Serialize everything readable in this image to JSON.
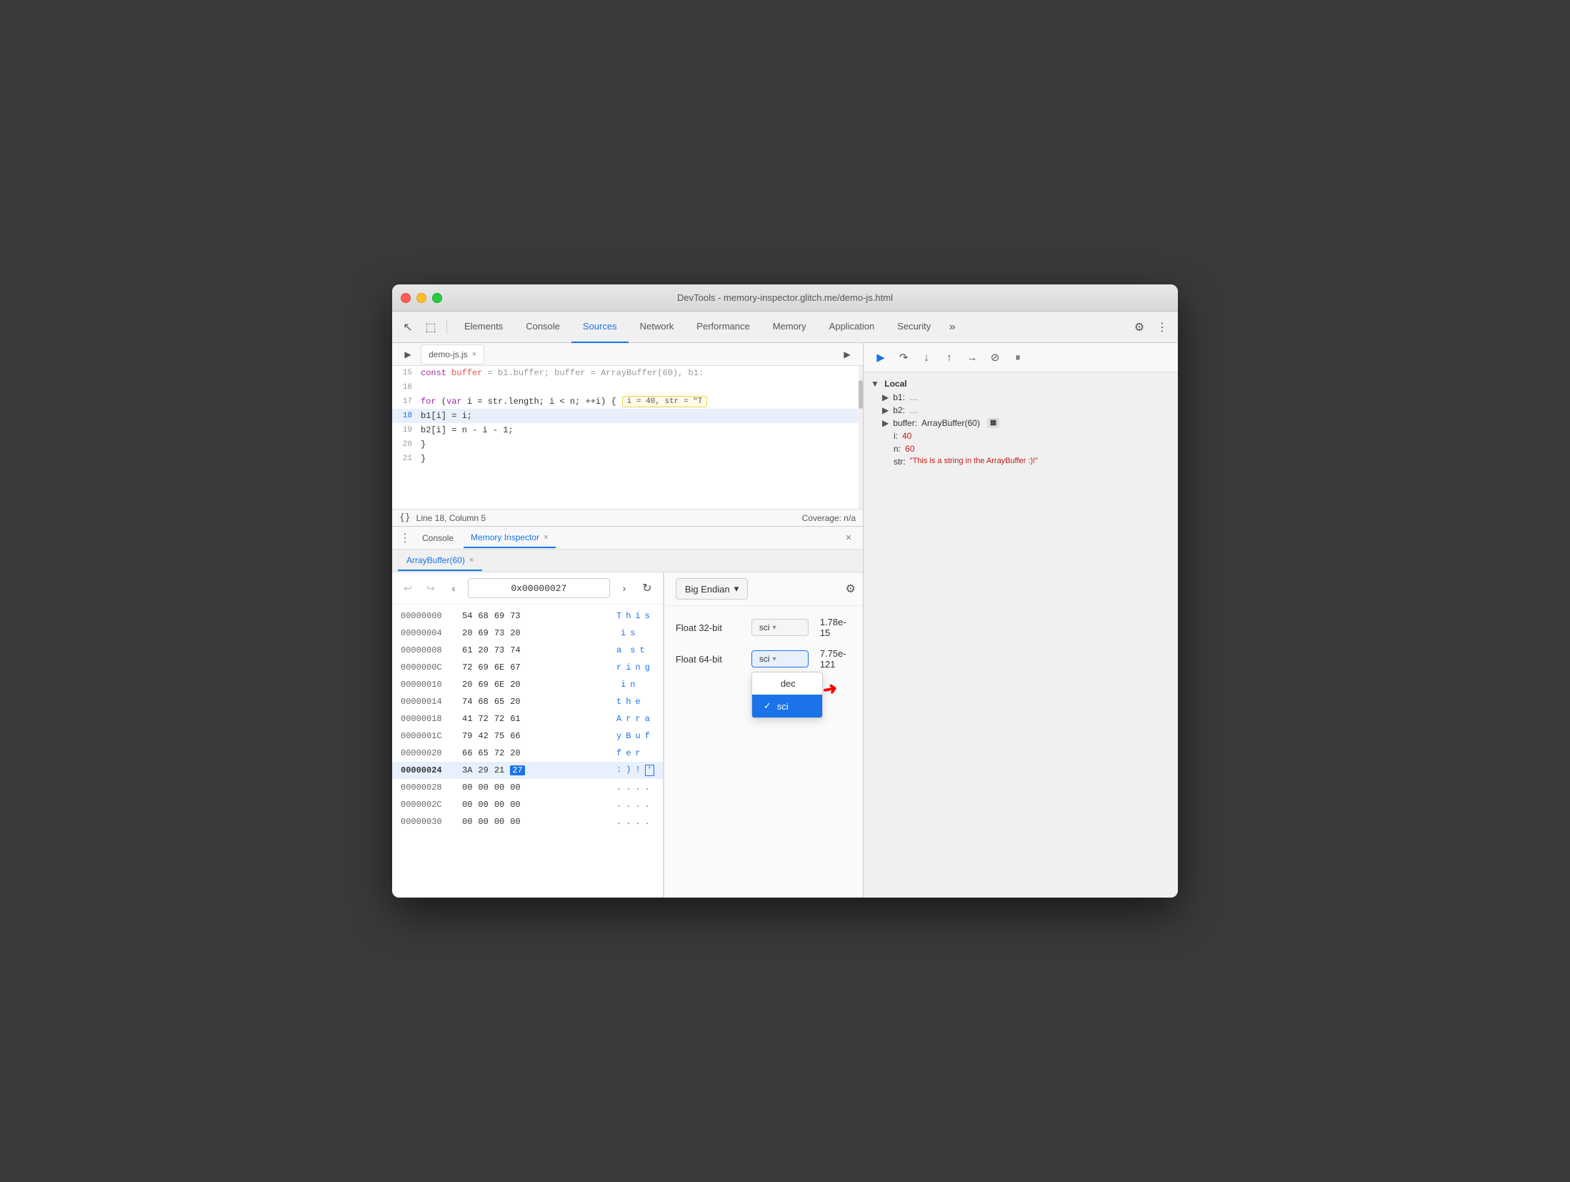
{
  "window": {
    "title": "DevTools - memory-inspector.glitch.me/demo-js.html",
    "traffic_lights": [
      "red",
      "yellow",
      "green"
    ]
  },
  "devtools": {
    "tabs": [
      {
        "id": "elements",
        "label": "Elements",
        "active": false
      },
      {
        "id": "console",
        "label": "Console",
        "active": false
      },
      {
        "id": "sources",
        "label": "Sources",
        "active": true
      },
      {
        "id": "network",
        "label": "Network",
        "active": false
      },
      {
        "id": "performance",
        "label": "Performance",
        "active": false
      },
      {
        "id": "memory",
        "label": "Memory",
        "active": false
      },
      {
        "id": "application",
        "label": "Application",
        "active": false
      },
      {
        "id": "security",
        "label": "Security",
        "active": false
      }
    ],
    "file_tab": {
      "name": "demo-js.js",
      "has_close": true
    }
  },
  "code": {
    "lines": [
      {
        "num": "15",
        "content": "  const buffer = b1.buffer;  buffer = ArrayBuffer(60), b1:",
        "highlighted": false,
        "comment": true
      },
      {
        "num": "16",
        "content": "",
        "highlighted": false
      },
      {
        "num": "17",
        "content": "  for (var i = str.length; i < n; ++i) {",
        "highlighted": false,
        "annotation": "i = 40, str = \"T"
      },
      {
        "num": "18",
        "content": "    b1[i] = i;",
        "highlighted": true
      },
      {
        "num": "19",
        "content": "    b2[i] = n - i - 1;",
        "highlighted": false
      },
      {
        "num": "20",
        "content": "  }",
        "highlighted": false
      },
      {
        "num": "21",
        "content": "}",
        "highlighted": false
      }
    ]
  },
  "status_bar": {
    "left": "Line 18, Column 5",
    "right": "Coverage: n/a",
    "braces": "{}"
  },
  "panel": {
    "tabs": [
      {
        "id": "console",
        "label": "Console",
        "active": false
      },
      {
        "id": "memory-inspector",
        "label": "Memory Inspector",
        "active": true,
        "has_close": true
      }
    ]
  },
  "memory_inspector": {
    "sub_tab": "ArrayBuffer(60)",
    "address": "0x00000027",
    "rows": [
      {
        "addr": "00000000",
        "bytes": [
          "54",
          "68",
          "69",
          "73"
        ],
        "chars": [
          "T",
          "h",
          "i",
          "s"
        ],
        "highlighted": false
      },
      {
        "addr": "00000004",
        "bytes": [
          "20",
          "69",
          "73",
          "20"
        ],
        "chars": [
          "",
          "i",
          "s",
          ""
        ],
        "highlighted": false
      },
      {
        "addr": "00000008",
        "bytes": [
          "61",
          "20",
          "73",
          "74"
        ],
        "chars": [
          "a",
          "",
          "s",
          "t"
        ],
        "highlighted": false
      },
      {
        "addr": "0000000C",
        "bytes": [
          "72",
          "69",
          "6E",
          "67"
        ],
        "chars": [
          "r",
          "i",
          "n",
          "g"
        ],
        "highlighted": false
      },
      {
        "addr": "00000010",
        "bytes": [
          "20",
          "69",
          "6E",
          "20"
        ],
        "chars": [
          "",
          "i",
          "n",
          ""
        ],
        "highlighted": false
      },
      {
        "addr": "00000014",
        "bytes": [
          "74",
          "68",
          "65",
          "20"
        ],
        "chars": [
          "t",
          "h",
          "e",
          ""
        ],
        "highlighted": false
      },
      {
        "addr": "00000018",
        "bytes": [
          "41",
          "72",
          "72",
          "61"
        ],
        "chars": [
          "A",
          "r",
          "r",
          "a"
        ],
        "highlighted": false
      },
      {
        "addr": "0000001C",
        "bytes": [
          "79",
          "42",
          "75",
          "66"
        ],
        "chars": [
          "y",
          "B",
          "u",
          "f"
        ],
        "highlighted": false
      },
      {
        "addr": "00000020",
        "bytes": [
          "66",
          "65",
          "72",
          "20"
        ],
        "chars": [
          "f",
          "e",
          "r",
          ""
        ],
        "highlighted": false
      },
      {
        "addr": "00000024",
        "bytes": [
          "3A",
          "29",
          "21",
          "27"
        ],
        "chars": [
          ":",
          ")",
          "!",
          "'"
        ],
        "highlighted": true,
        "selected_byte": 3
      },
      {
        "addr": "00000028",
        "bytes": [
          "00",
          "00",
          "00",
          "00"
        ],
        "chars": [
          ".",
          ".",
          ".",
          "."
        ],
        "highlighted": false
      },
      {
        "addr": "0000002C",
        "bytes": [
          "00",
          "00",
          "00",
          "00"
        ],
        "chars": [
          ".",
          ".",
          ".",
          "."
        ],
        "highlighted": false
      },
      {
        "addr": "00000030",
        "bytes": [
          "00",
          "00",
          "00",
          "00"
        ],
        "chars": [
          ".",
          ".",
          ".",
          "."
        ],
        "highlighted": false
      }
    ]
  },
  "float_inspector": {
    "endian": "Big Endian",
    "rows": [
      {
        "label": "Float 32-bit",
        "format": "sci",
        "value": "1.78e-15"
      },
      {
        "label": "Float 64-bit",
        "format": "sci",
        "value": "7.75e-121"
      }
    ],
    "dropdown": {
      "visible": true,
      "options": [
        {
          "value": "dec",
          "label": "dec",
          "selected": false
        },
        {
          "value": "sci",
          "label": "sci",
          "selected": true
        }
      ]
    }
  },
  "scope": {
    "title": "Local",
    "items": [
      {
        "key": "b1:",
        "value": "…",
        "expandable": true
      },
      {
        "key": "b2:",
        "value": "…",
        "expandable": true
      },
      {
        "key": "buffer:",
        "value": "ArrayBuffer(60)",
        "expandable": true,
        "has_icon": true
      },
      {
        "key": "i:",
        "value": "40",
        "expandable": false
      },
      {
        "key": "n:",
        "value": "60",
        "expandable": false
      },
      {
        "key": "str:",
        "value": "\"This is a string in the ArrayBuffer :)!\"",
        "expandable": false
      }
    ]
  },
  "icons": {
    "back": "↩",
    "forward": "↪",
    "cursor": "↖",
    "device": "◻",
    "prev_addr": "‹",
    "next_addr": "›",
    "refresh": "↻",
    "chevron_down": "▾",
    "play": "▶",
    "pause": "⏸",
    "step_over": "⟳",
    "resume": "▷",
    "gear": "⚙",
    "more": "⋮",
    "chevron_right": "▶",
    "settings": "⚙",
    "close": "×"
  }
}
